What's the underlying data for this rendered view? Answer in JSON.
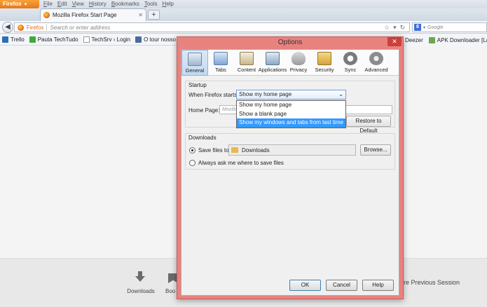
{
  "browser": {
    "app_button": "Firefox",
    "menu": [
      "File",
      "Edit",
      "View",
      "History",
      "Bookmarks",
      "Tools",
      "Help"
    ],
    "tab_title": "Mozilla Firefox Start Page",
    "new_tab": "+",
    "url_label": "Firefox",
    "url_placeholder": "Search or enter address",
    "search_placeholder": "Google",
    "bookmarks": [
      "Trello",
      "Pauta TechTudo",
      "TechSrv › Login",
      "O tour nosso de cada..."
    ],
    "bookmarks_right": [
      "Deezer",
      "APK Downloader [Late..."
    ]
  },
  "start_page": {
    "downloads_label": "Downloads",
    "bookmarks_partial": "Boo",
    "restore_session": "re Previous Session"
  },
  "dialog": {
    "title": "Options",
    "close": "✕",
    "panes": [
      {
        "label": "General",
        "icon": "general-icon",
        "color": "#9fb7cf",
        "selected": true
      },
      {
        "label": "Tabs",
        "icon": "tabs-icon",
        "color": "#7fa6d6"
      },
      {
        "label": "Content",
        "icon": "content-icon",
        "color": "#c9b68a"
      },
      {
        "label": "Applications",
        "icon": "applications-icon",
        "color": "#8ca8c4"
      },
      {
        "label": "Privacy",
        "icon": "privacy-icon",
        "color": "#9a9a9a"
      },
      {
        "label": "Security",
        "icon": "security-icon",
        "color": "#d4a23a"
      },
      {
        "label": "Sync",
        "icon": "sync-icon",
        "color": "#7a7a7a"
      },
      {
        "label": "Advanced",
        "icon": "advanced-icon",
        "color": "#8c8c8c"
      }
    ],
    "startup": {
      "group_label": "Startup",
      "when_label": "When Firefox starts:",
      "selected": "Show my home page",
      "options": [
        "Show my home page",
        "Show a blank page",
        "Show my windows and tabs from last time"
      ],
      "home_label": "Home Page:",
      "home_placeholder": "Mozilla",
      "restore_default": "Restore to Default"
    },
    "downloads": {
      "group_label": "Downloads",
      "save_label": "Save files to",
      "folder": "Downloads",
      "browse": "Browse...",
      "ask_label": "Always ask me where to save files"
    },
    "buttons": {
      "ok": "OK",
      "cancel": "Cancel",
      "help": "Help"
    }
  }
}
